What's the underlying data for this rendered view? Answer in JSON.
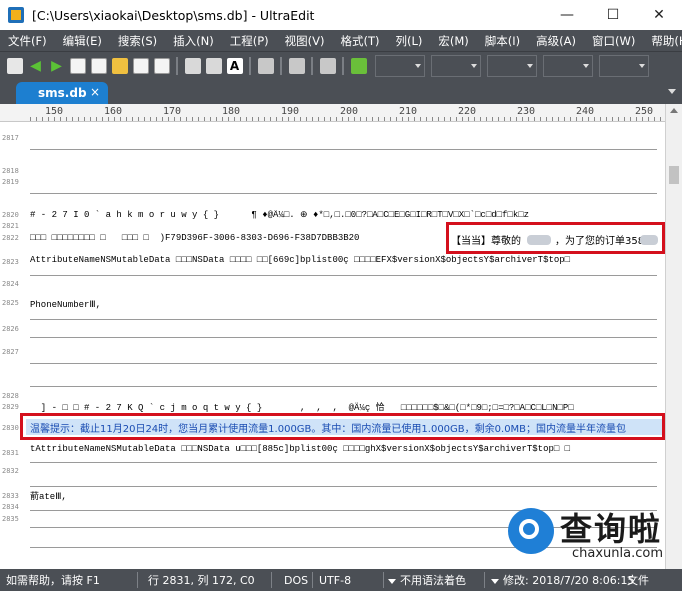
{
  "window": {
    "title": "[C:\\Users\\xiaokai\\Desktop\\sms.db] - UltraEdit",
    "minimize": "—",
    "maximize": "☐",
    "close": "✕"
  },
  "menu": [
    "文件(F)",
    "编辑(E)",
    "搜索(S)",
    "插入(N)",
    "工程(P)",
    "视图(V)",
    "格式(T)",
    "列(L)",
    "宏(M)",
    "脚本(I)",
    "高级(A)",
    "窗口(W)",
    "帮助(H)"
  ],
  "tab": {
    "label": "sms.db",
    "close": "×"
  },
  "ruler": [
    "150",
    "160",
    "170",
    "180",
    "190",
    "200",
    "210",
    "220",
    "230",
    "240",
    "250"
  ],
  "line_numbers": [
    "2817",
    "2818",
    "2819",
    "2820",
    "2821",
    "2822",
    "2823",
    "2824",
    "2825",
    "2826",
    "2827",
    "2828",
    "2829",
    "2830",
    "2831",
    "2832",
    "2833",
    "2834",
    "2835"
  ],
  "lines": {
    "l2821": "# - 2 7 I 0 ` a h k m o r u w y { }      ¶ ♦@Ä¼□. ⊕ ♦*□,□.□0□?□A□C□E□G□I□R□T□V□X□`□c□d□f□k□z",
    "l2822a": "□□□ □□□□□□□□ □   □□□ □  )F79D396F-3006-8303-D696-F38D7DBB3B20",
    "l2822b": "【当当】尊敬的",
    "l2822c": "，为了您的订单358",
    "l2823": "AttributeNameNSMutableData □□□NSData □□□□ □□[669c]bplist00ç □□□□EFX$versionX$objectsY$archiverT$top□",
    "l2825": "PhoneNumberⅢ,",
    "l2829": "  ] - □ □ # - 2 7 K Q ` c j m o q t w y { }       ,  ,  ,  @Ä¼ç 恰   □□□□□□$□&□(□*□9□;□=□?□A□C□L□N□P□",
    "l2830": "温馨提示：截止11月20日24时，您当月累计使用流量1.000GB。其中：国内流量已使用1.000GB，剩余0.0MB；国内流量半年流量包",
    "l2831": "tAttributeNameNSMutableData □□□NSData u□□□[885c]bplist00ç □□□□ghX$versionX$objectsY$archiverT$top□ □",
    "l2833": "葥ateⅢ,"
  },
  "status": {
    "help": "如需帮助，请按 F1",
    "position": "行 2831, 列 172, C0",
    "line_ending": "DOS",
    "encoding": "UTF-8",
    "syntax": "不用语法着色",
    "modified": "修改: 2018/7/20 8:06:15",
    "extra": "文件"
  },
  "watermark": {
    "big": "查询啦",
    "small": "chaxunla.com"
  },
  "colors": {
    "chrome": "#4b4f55",
    "tab": "#1d7fd0",
    "highlight": "#d4101d",
    "selected_line": "#cfe3f8"
  }
}
